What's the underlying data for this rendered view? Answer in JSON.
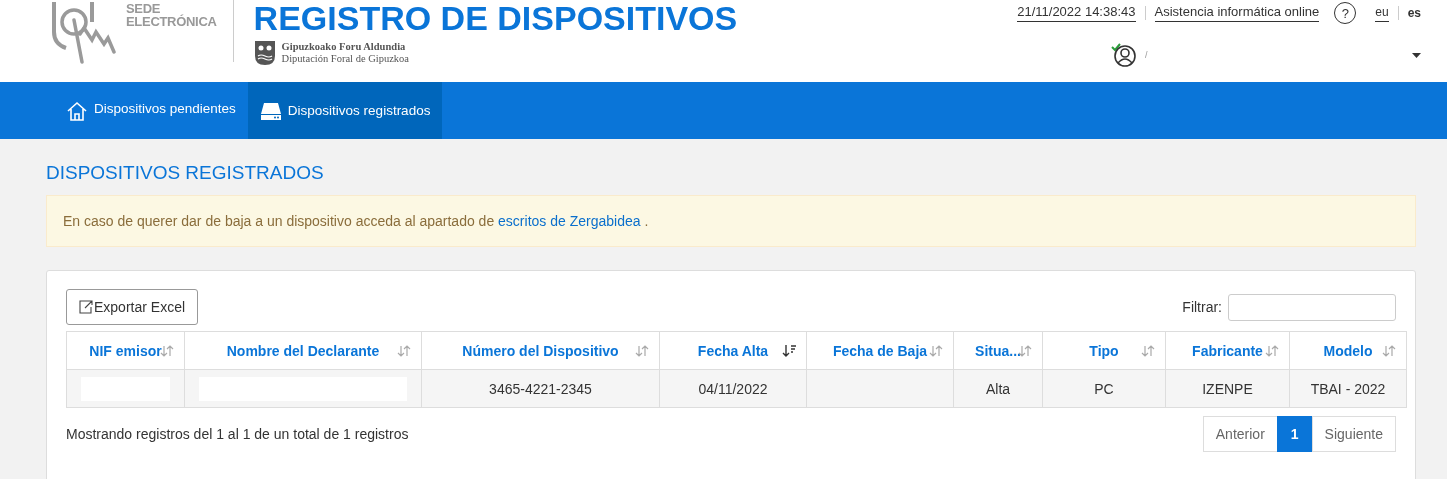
{
  "header": {
    "logo_text": [
      "SEDE",
      "ELECTRÓNICA"
    ],
    "title": "REGISTRO DE DISPOSITIVOS",
    "org": [
      "Gipuzkoako Foru Aldundia",
      "Diputación Foral de Gipuzkoa"
    ],
    "datetime": "21/11/2022  14:38:43",
    "help_link": "Asistencia informática online",
    "help_icon": "?",
    "languages": [
      {
        "label": "eu",
        "selected": false
      },
      {
        "label": "es",
        "selected": true
      }
    ],
    "user": {
      "name": "/"
    }
  },
  "nav": [
    {
      "label": "Dispositivos pendientes",
      "selected": false
    },
    {
      "label": "Dispositivos registrados",
      "selected": true
    }
  ],
  "page_title": "DISPOSITIVOS REGISTRADOS",
  "notice": {
    "text": "En caso de querer dar de baja a un dispositivo acceda al apartado de",
    "link": "escritos de Zergabidea",
    "end": "."
  },
  "export_button": "Exportar Excel",
  "filter": {
    "label": "Filtrar:"
  },
  "table": {
    "columns": [
      {
        "label": "NIF emisor",
        "sorted": false
      },
      {
        "label": "Nombre del Declarante",
        "sorted": false
      },
      {
        "label": "Número del Dispositivo",
        "sorted": false
      },
      {
        "label": "Fecha Alta",
        "sorted": true
      },
      {
        "label": "Fecha de Baja",
        "sorted": false
      },
      {
        "label": "Situa...",
        "sorted": false
      },
      {
        "label": "Tipo",
        "sorted": false
      },
      {
        "label": "Fabricante",
        "sorted": false
      },
      {
        "label": "Modelo",
        "sorted": false
      }
    ],
    "rows": [
      {
        "cells": [
          {
            "redacted": true
          },
          {
            "redacted": true
          },
          {
            "text": "3465-4221-2345"
          },
          {
            "text": "04/11/2022"
          },
          {},
          {
            "text": "Alta"
          },
          {
            "text": "PC"
          },
          {
            "text": "IZENPE"
          },
          {
            "text": "TBAI - 2022"
          }
        ]
      }
    ]
  },
  "summary": "Mostrando registros del 1 al 1 de un total de 1 registros",
  "pagination": [
    {
      "label": "Anterior",
      "selected": false
    },
    {
      "label": "1",
      "selected": true
    },
    {
      "label": "Siguiente",
      "selected": false
    }
  ]
}
